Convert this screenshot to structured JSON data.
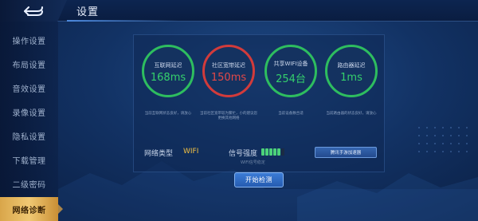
{
  "header": {
    "title": "设置",
    "back_icon": "back-arrow-icon"
  },
  "sidebar": {
    "items": [
      {
        "label": "操作设置",
        "active": false
      },
      {
        "label": "布局设置",
        "active": false
      },
      {
        "label": "音效设置",
        "active": false
      },
      {
        "label": "录像设置",
        "active": false
      },
      {
        "label": "隐私设置",
        "active": false
      },
      {
        "label": "下载管理",
        "active": false
      },
      {
        "label": "二级密码",
        "active": false
      },
      {
        "label": "网络诊断",
        "active": true
      }
    ]
  },
  "diagnostics": {
    "gauges": [
      {
        "label": "互联网延迟",
        "value": "168ms",
        "status": "good",
        "desc": "当前互联网状态良好，请放心"
      },
      {
        "label": "社区宽带延迟",
        "value": "150ms",
        "status": "bad",
        "desc": "当前社区宽带较为繁忙，小的建议您更换其他网络"
      },
      {
        "label": "共享WIFI设备",
        "value": "254台",
        "status": "good",
        "desc": "当前设备数合适"
      },
      {
        "label": "路由器延迟",
        "value": "1ms",
        "status": "good",
        "desc": "当前路由器的状态良好，请放心"
      }
    ],
    "network_type_label": "网络类型",
    "network_type_value": "WIFI",
    "signal_label": "信号强度",
    "signal_level": "5/6",
    "signal_subtext": "WIFI信号稳定",
    "accelerator_button": "腾讯手游加速器",
    "start_button": "开始检测"
  },
  "colors": {
    "good": "#2ebd5f",
    "bad": "#d23b3b",
    "accent": "#f2c043",
    "active_tab": "#e6b35a"
  }
}
